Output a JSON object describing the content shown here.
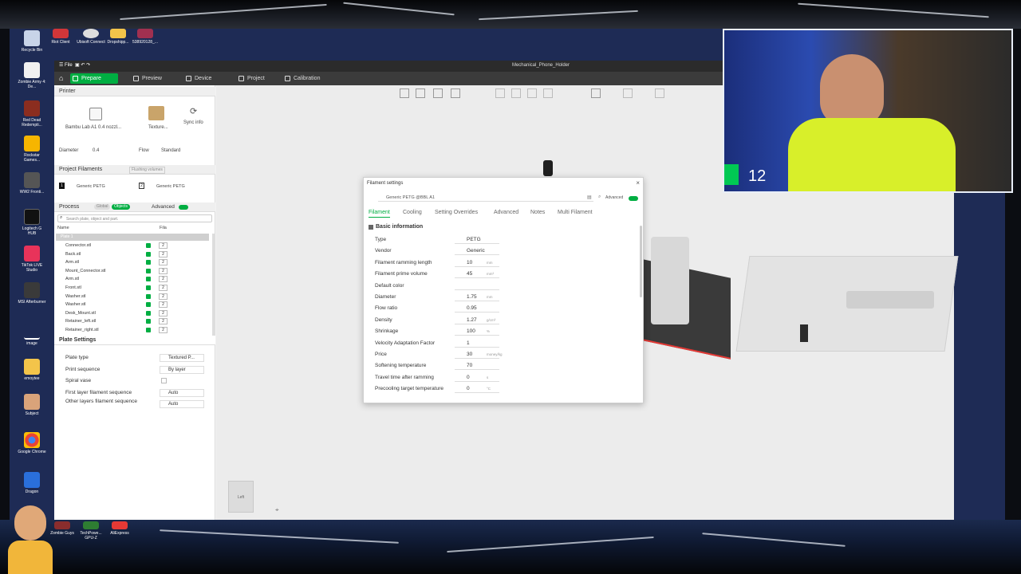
{
  "app": {
    "window_title": "Mechanical_Phone_Holder",
    "menu_label": "File",
    "tabs": [
      {
        "label": "Prepare",
        "active": true
      },
      {
        "label": "Preview"
      },
      {
        "label": "Device"
      },
      {
        "label": "Project"
      },
      {
        "label": "Calibration"
      }
    ]
  },
  "printer": {
    "section_title": "Printer",
    "printer_name": "Bambu Lab A1 0.4 nozzl...",
    "plate_label": "Texture...",
    "sync_label": "Sync info",
    "diameter_label": "Diameter",
    "diameter_value": "0.4",
    "flow_label": "Flow",
    "flow_value": "Standard"
  },
  "filaments": {
    "section_title": "Project Filaments",
    "flushing_label": "Flushing volumes",
    "items": [
      {
        "index": "1",
        "name": "Generic PETG"
      },
      {
        "index": "2",
        "name": "Generic PETG"
      }
    ]
  },
  "process": {
    "section_title": "Process",
    "global_label": "Global",
    "objects_label": "Objects",
    "advanced_label": "Advanced",
    "search_placeholder": "Search plate, object and part.",
    "col_name": "Name",
    "col_fila": "Fila",
    "plate_label": "Plate 1",
    "objects": [
      {
        "name": "Connector.stl",
        "fila": "2"
      },
      {
        "name": "Back.stl",
        "fila": "2"
      },
      {
        "name": "Arm.stl",
        "fila": "2"
      },
      {
        "name": "Mount_Connector.stl",
        "fila": "2"
      },
      {
        "name": "Arm.stl",
        "fila": "2"
      },
      {
        "name": "Front.stl",
        "fila": "2"
      },
      {
        "name": "Washer.stl",
        "fila": "2"
      },
      {
        "name": "Washer.stl",
        "fila": "2"
      },
      {
        "name": "Desk_Mount.stl",
        "fila": "2"
      },
      {
        "name": "Retainer_left.stl",
        "fila": "2"
      },
      {
        "name": "Retainer_right.stl",
        "fila": "2"
      }
    ]
  },
  "plate_settings": {
    "section_title": "Plate Settings",
    "rows": [
      {
        "label": "Plate type",
        "value": "Textured P..."
      },
      {
        "label": "Print sequence",
        "value": "By layer"
      },
      {
        "label": "Spiral vase",
        "value": ""
      },
      {
        "label": "First layer filament sequence",
        "value": "Auto"
      },
      {
        "label": "Other layers filament sequence",
        "value": "Auto"
      }
    ]
  },
  "viewport": {
    "view_label": "Left"
  },
  "dialog": {
    "title": "Filament settings",
    "preset_name": "Generic PETG @BBL A1",
    "advanced_label": "Advanced",
    "tabs": [
      "Filament",
      "Cooling",
      "Setting Overrides",
      "Advanced",
      "Notes",
      "Multi Filament"
    ],
    "section_title": "Basic information",
    "props": [
      {
        "label": "Type",
        "value": "PETG",
        "unit": ""
      },
      {
        "label": "Vendor",
        "value": "Generic",
        "unit": ""
      },
      {
        "label": "Filament ramming length",
        "value": "10",
        "unit": "mm"
      },
      {
        "label": "Filament prime volume",
        "value": "45",
        "unit": "mm³"
      },
      {
        "label": "Default color",
        "value": "",
        "unit": ""
      },
      {
        "label": "Diameter",
        "value": "1.75",
        "unit": "mm"
      },
      {
        "label": "Flow ratio",
        "value": "0.95",
        "unit": ""
      },
      {
        "label": "Density",
        "value": "1.27",
        "unit": "g/cm³"
      },
      {
        "label": "Shrinkage",
        "value": "100",
        "unit": "%"
      },
      {
        "label": "Velocity Adaptation Factor",
        "value": "1",
        "unit": ""
      },
      {
        "label": "Price",
        "value": "30",
        "unit": "money/kg"
      },
      {
        "label": "Softening temperature",
        "value": "70",
        "unit": ""
      },
      {
        "label": "Travel time after ramming",
        "value": "0",
        "unit": "s"
      },
      {
        "label": "Precooling target temperature",
        "value": "0",
        "unit": "°C"
      }
    ]
  },
  "desktop_icons": [
    "Recycle Bin",
    "Zombie Army 4: De...",
    "Red Dead Redempti...",
    "Rockstar Games...",
    "WW2 Fronti...",
    "Logitech G HUB",
    "TikTok LIVE Studio",
    "MSI Afterburner",
    "image",
    "emoytee",
    "Subject",
    "Google Chrome",
    "Dragon"
  ],
  "top_icons": [
    "Riot Client",
    "Ubisoft Connect",
    "Dropshipp...",
    "538920128_..."
  ],
  "taskbar_icons": [
    "Zombie Guys",
    "TechPowe... GPU-Z",
    "AliExpress"
  ],
  "webcam": {
    "overlay_number": "12"
  },
  "colors": {
    "accent": "#00ae42",
    "titlebar": "#2b2b2b"
  }
}
